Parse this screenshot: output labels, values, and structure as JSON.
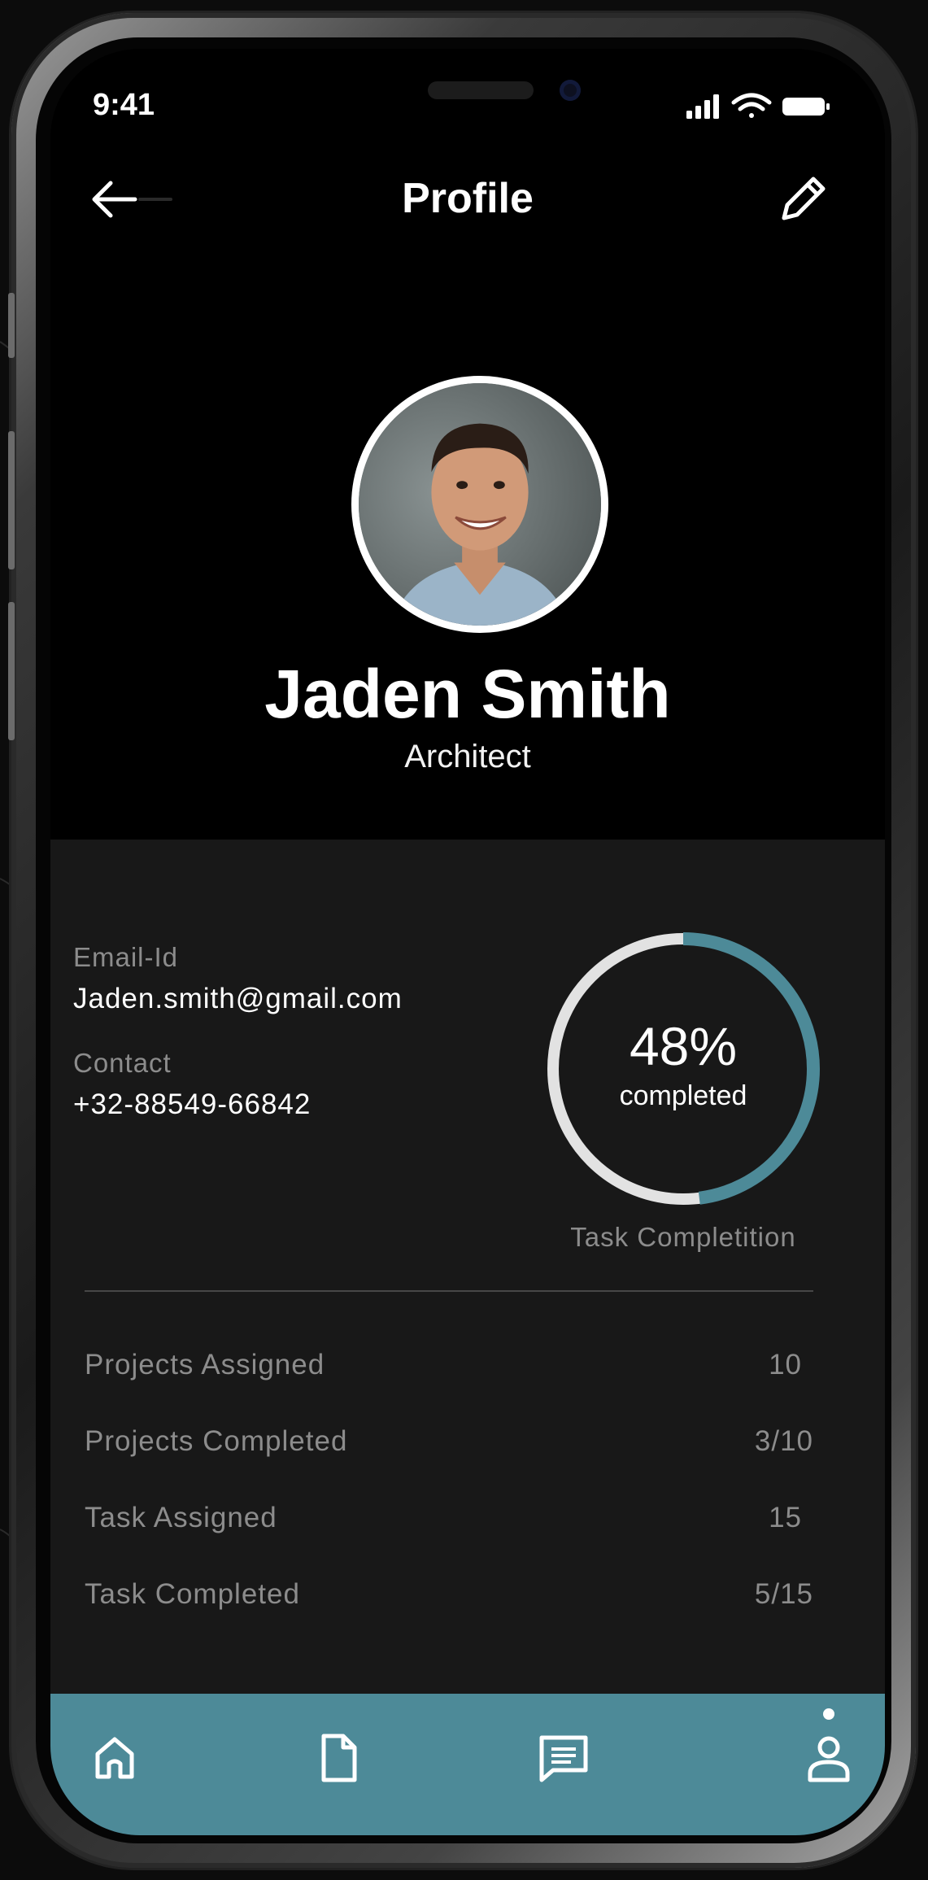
{
  "status_bar": {
    "time": "9:41"
  },
  "header": {
    "title": "Profile"
  },
  "profile": {
    "name": "Jaden Smith",
    "role": "Architect"
  },
  "details": {
    "email_label": "Email-Id",
    "email_value": "Jaden.smith@gmail.com",
    "contact_label": "Contact",
    "contact_value": "+32-88549-66842"
  },
  "progress": {
    "percent_text": "48%",
    "percent_value": 48,
    "sub_label": "completed",
    "caption": "Task Completition",
    "track_color": "#e2e2e2",
    "fill_color": "#4d8a98"
  },
  "stats": [
    {
      "label": "Projects Assigned",
      "value": "10"
    },
    {
      "label": "Projects Completed",
      "value": "3/10"
    },
    {
      "label": "Task Assigned",
      "value": "15"
    },
    {
      "label": "Task Completed",
      "value": "5/15"
    }
  ],
  "bottom_nav": {
    "items": [
      {
        "icon": "home-icon"
      },
      {
        "icon": "document-icon"
      },
      {
        "icon": "chat-icon"
      },
      {
        "icon": "profile-icon",
        "active": true
      }
    ],
    "color": "#4d8a98"
  }
}
